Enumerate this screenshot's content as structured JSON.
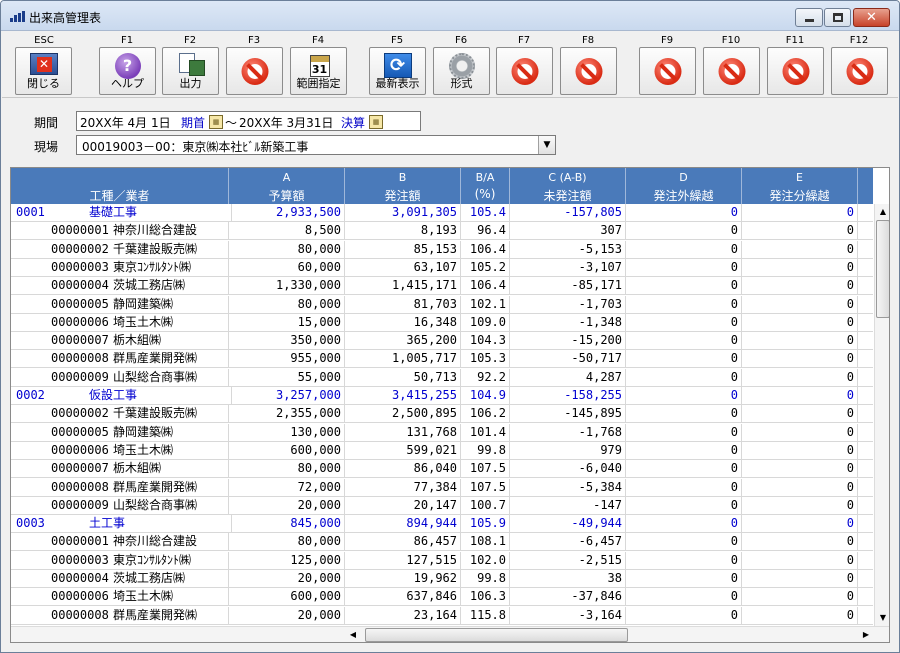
{
  "window": {
    "title": "出来高管理表"
  },
  "toolbar": {
    "buttons": [
      {
        "key": "ESC",
        "label": "閉じる",
        "icon": "close-icon"
      },
      {
        "key": "F1",
        "label": "ヘルプ",
        "icon": "help-icon"
      },
      {
        "key": "F2",
        "label": "出力",
        "icon": "output-icon"
      },
      {
        "key": "F3",
        "label": "",
        "icon": "disabled-icon"
      },
      {
        "key": "F4",
        "label": "範囲指定",
        "icon": "calendar-icon",
        "icon_text": "31"
      },
      {
        "key": "F5",
        "label": "最新表示",
        "icon": "refresh-icon"
      },
      {
        "key": "F6",
        "label": "形式",
        "icon": "gear-icon"
      },
      {
        "key": "F7",
        "label": "",
        "icon": "disabled-icon"
      },
      {
        "key": "F8",
        "label": "",
        "icon": "disabled-icon"
      },
      {
        "key": "F9",
        "label": "",
        "icon": "disabled-icon"
      },
      {
        "key": "F10",
        "label": "",
        "icon": "disabled-icon"
      },
      {
        "key": "F11",
        "label": "",
        "icon": "disabled-icon"
      },
      {
        "key": "F12",
        "label": "",
        "icon": "disabled-icon"
      }
    ]
  },
  "filter": {
    "period_label": "期間",
    "period_start": "20XX年 4月 1日",
    "period_start_link": "期首",
    "period_sep": "～",
    "period_end": "20XX年 3月31日",
    "period_end_link": "決算",
    "site_label": "現場",
    "site_value": "00019003－00：東京㈱本社ﾋﾞﾙ新築工事",
    "dropdown_arrow": "▼"
  },
  "grid": {
    "columns": [
      {
        "key": "",
        "label": "工種／業者"
      },
      {
        "key": "A",
        "label": "予算額"
      },
      {
        "key": "B",
        "label": "発注額"
      },
      {
        "key": "B/A",
        "label": "(%)"
      },
      {
        "key": "C (A-B)",
        "label": "未発注額"
      },
      {
        "key": "D",
        "label": "発注外繰越"
      },
      {
        "key": "E",
        "label": "発注分繰越"
      }
    ],
    "rows": [
      {
        "kind": "cat",
        "code": "0001",
        "name": "基礎工事",
        "a": "2,933,500",
        "b": "3,091,305",
        "pct": "105.4",
        "c": "-157,805",
        "d": "0",
        "e": "0"
      },
      {
        "kind": "item",
        "code": "00000001",
        "name": "神奈川総合建設",
        "a": "8,500",
        "b": "8,193",
        "pct": "96.4",
        "c": "307",
        "d": "0",
        "e": "0"
      },
      {
        "kind": "item",
        "code": "00000002",
        "name": "千葉建設販売㈱",
        "a": "80,000",
        "b": "85,153",
        "pct": "106.4",
        "c": "-5,153",
        "d": "0",
        "e": "0"
      },
      {
        "kind": "item",
        "code": "00000003",
        "name": "東京ｺﾝｻﾙﾀﾝﾄ㈱",
        "a": "60,000",
        "b": "63,107",
        "pct": "105.2",
        "c": "-3,107",
        "d": "0",
        "e": "0"
      },
      {
        "kind": "item",
        "code": "00000004",
        "name": "茨城工務店㈱",
        "a": "1,330,000",
        "b": "1,415,171",
        "pct": "106.4",
        "c": "-85,171",
        "d": "0",
        "e": "0"
      },
      {
        "kind": "item",
        "code": "00000005",
        "name": "静岡建築㈱",
        "a": "80,000",
        "b": "81,703",
        "pct": "102.1",
        "c": "-1,703",
        "d": "0",
        "e": "0"
      },
      {
        "kind": "item",
        "code": "00000006",
        "name": "埼玉土木㈱",
        "a": "15,000",
        "b": "16,348",
        "pct": "109.0",
        "c": "-1,348",
        "d": "0",
        "e": "0"
      },
      {
        "kind": "item",
        "code": "00000007",
        "name": "栃木組㈱",
        "a": "350,000",
        "b": "365,200",
        "pct": "104.3",
        "c": "-15,200",
        "d": "0",
        "e": "0"
      },
      {
        "kind": "item",
        "code": "00000008",
        "name": "群馬産業開発㈱",
        "a": "955,000",
        "b": "1,005,717",
        "pct": "105.3",
        "c": "-50,717",
        "d": "0",
        "e": "0"
      },
      {
        "kind": "item",
        "code": "00000009",
        "name": "山梨総合商事㈱",
        "a": "55,000",
        "b": "50,713",
        "pct": "92.2",
        "c": "4,287",
        "d": "0",
        "e": "0"
      },
      {
        "kind": "cat",
        "code": "0002",
        "name": "仮設工事",
        "a": "3,257,000",
        "b": "3,415,255",
        "pct": "104.9",
        "c": "-158,255",
        "d": "0",
        "e": "0"
      },
      {
        "kind": "item",
        "code": "00000002",
        "name": "千葉建設販売㈱",
        "a": "2,355,000",
        "b": "2,500,895",
        "pct": "106.2",
        "c": "-145,895",
        "d": "0",
        "e": "0"
      },
      {
        "kind": "item",
        "code": "00000005",
        "name": "静岡建築㈱",
        "a": "130,000",
        "b": "131,768",
        "pct": "101.4",
        "c": "-1,768",
        "d": "0",
        "e": "0"
      },
      {
        "kind": "item",
        "code": "00000006",
        "name": "埼玉土木㈱",
        "a": "600,000",
        "b": "599,021",
        "pct": "99.8",
        "c": "979",
        "d": "0",
        "e": "0"
      },
      {
        "kind": "item",
        "code": "00000007",
        "name": "栃木組㈱",
        "a": "80,000",
        "b": "86,040",
        "pct": "107.5",
        "c": "-6,040",
        "d": "0",
        "e": "0"
      },
      {
        "kind": "item",
        "code": "00000008",
        "name": "群馬産業開発㈱",
        "a": "72,000",
        "b": "77,384",
        "pct": "107.5",
        "c": "-5,384",
        "d": "0",
        "e": "0"
      },
      {
        "kind": "item",
        "code": "00000009",
        "name": "山梨総合商事㈱",
        "a": "20,000",
        "b": "20,147",
        "pct": "100.7",
        "c": "-147",
        "d": "0",
        "e": "0"
      },
      {
        "kind": "cat",
        "code": "0003",
        "name": "土工事",
        "a": "845,000",
        "b": "894,944",
        "pct": "105.9",
        "c": "-49,944",
        "d": "0",
        "e": "0"
      },
      {
        "kind": "item",
        "code": "00000001",
        "name": "神奈川総合建設",
        "a": "80,000",
        "b": "86,457",
        "pct": "108.1",
        "c": "-6,457",
        "d": "0",
        "e": "0"
      },
      {
        "kind": "item",
        "code": "00000003",
        "name": "東京ｺﾝｻﾙﾀﾝﾄ㈱",
        "a": "125,000",
        "b": "127,515",
        "pct": "102.0",
        "c": "-2,515",
        "d": "0",
        "e": "0"
      },
      {
        "kind": "item",
        "code": "00000004",
        "name": "茨城工務店㈱",
        "a": "20,000",
        "b": "19,962",
        "pct": "99.8",
        "c": "38",
        "d": "0",
        "e": "0"
      },
      {
        "kind": "item",
        "code": "00000006",
        "name": "埼玉土木㈱",
        "a": "600,000",
        "b": "637,846",
        "pct": "106.3",
        "c": "-37,846",
        "d": "0",
        "e": "0"
      },
      {
        "kind": "item",
        "code": "00000008",
        "name": "群馬産業開発㈱",
        "a": "20,000",
        "b": "23,164",
        "pct": "115.8",
        "c": "-3,164",
        "d": "0",
        "e": "0"
      }
    ]
  }
}
